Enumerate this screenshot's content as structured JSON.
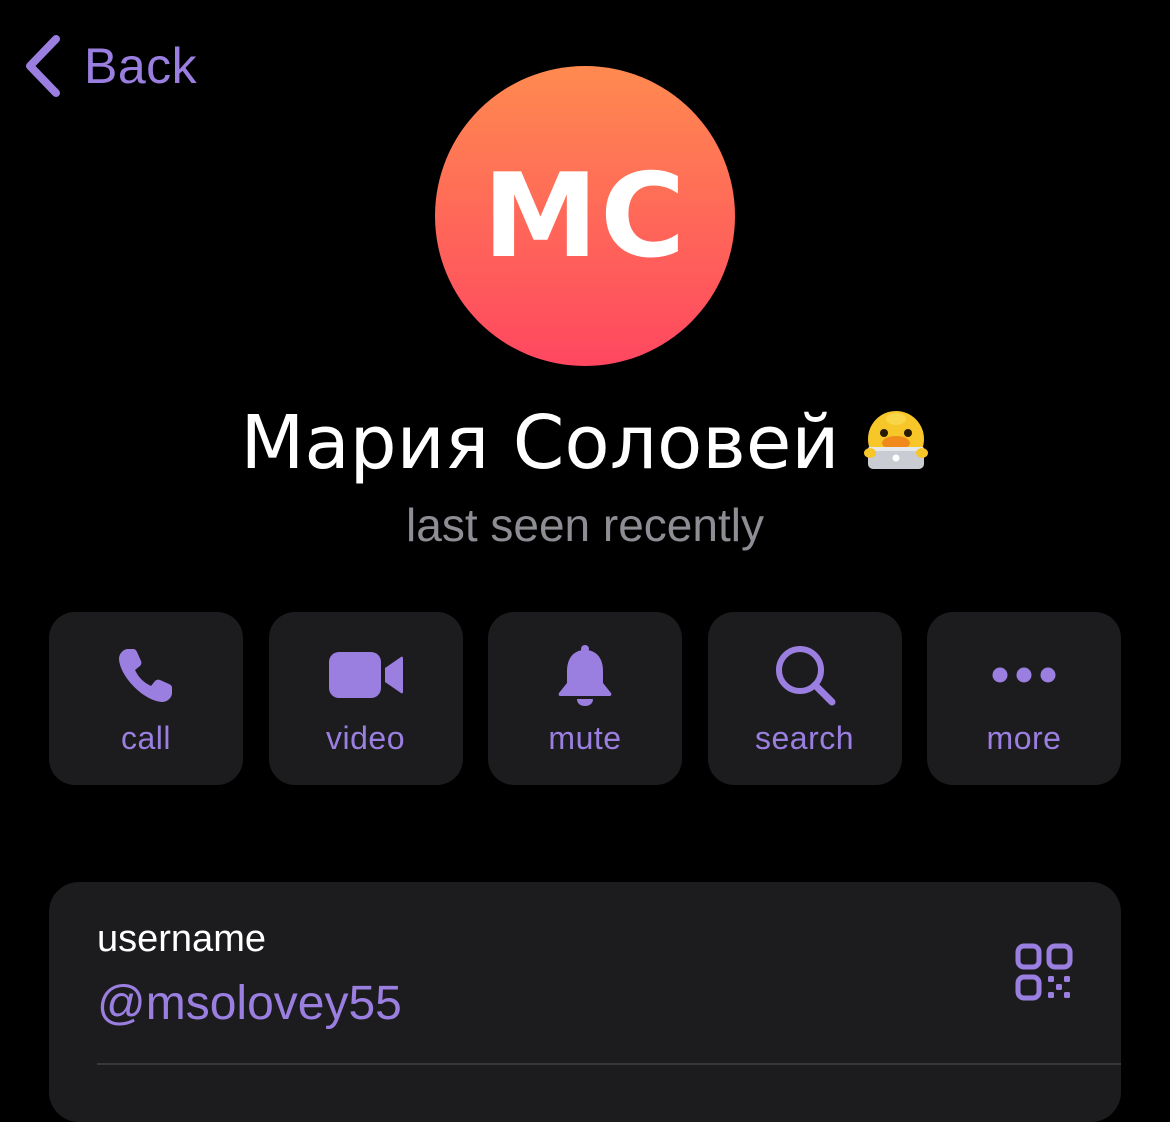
{
  "nav": {
    "back_label": "Back"
  },
  "profile": {
    "initials": "MC",
    "name": "Мария Соловей",
    "status": "last seen recently"
  },
  "actions": [
    {
      "label": "call",
      "icon": "phone-icon"
    },
    {
      "label": "video",
      "icon": "video-camera-icon"
    },
    {
      "label": "mute",
      "icon": "bell-icon"
    },
    {
      "label": "search",
      "icon": "search-icon"
    },
    {
      "label": "more",
      "icon": "more-dots-icon"
    }
  ],
  "info": {
    "username_label": "username",
    "username_value": "@msolovey55"
  },
  "colors": {
    "accent": "#9b7fe0",
    "background": "#000000",
    "card": "#1c1c1e",
    "secondary_text": "#8d8d93",
    "avatar_top": "#ff8a50",
    "avatar_bottom": "#ff4760"
  }
}
